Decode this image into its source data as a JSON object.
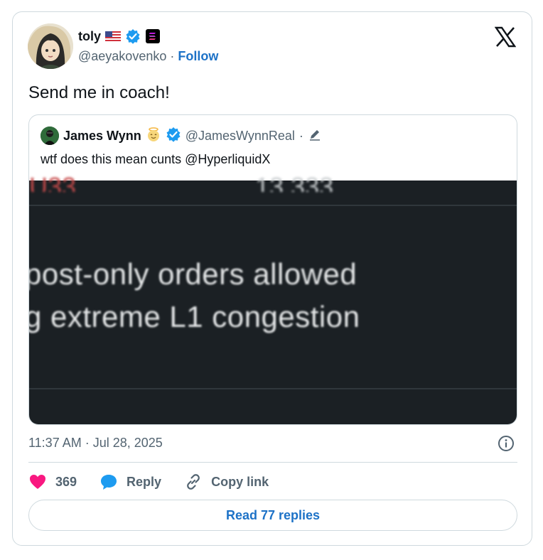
{
  "author": {
    "display_name": "toly",
    "handle": "@aeyakovenko",
    "separator": "·",
    "follow_label": "Follow"
  },
  "tweet": {
    "text": "Send me in coach!",
    "time": "11:37 AM",
    "separator": "·",
    "date": "Jul 28, 2025"
  },
  "quote": {
    "display_name": "James Wynn",
    "handle": "@JamesWynnReal",
    "separator": "·",
    "text": "wtf does this mean cunts @HyperliquidX",
    "media": {
      "line1": "post-only orders allowed",
      "line2": "g extreme L1 congestion"
    }
  },
  "actions": {
    "like_count": "369",
    "reply_label": "Reply",
    "copy_label": "Copy link"
  },
  "read_replies_label": "Read 77 replies",
  "colors": {
    "accent": "#1d72c7",
    "like": "#f91880",
    "verified": "#1d9bf0",
    "muted": "#536471",
    "border": "#cfd9de",
    "media_bg": "#1b2024"
  },
  "icons": [
    "x-logo-icon",
    "verified-icon",
    "us-flag-icon",
    "solana-icon",
    "edit-pencil-icon",
    "info-icon",
    "heart-icon",
    "reply-bubble-icon",
    "link-icon"
  ]
}
